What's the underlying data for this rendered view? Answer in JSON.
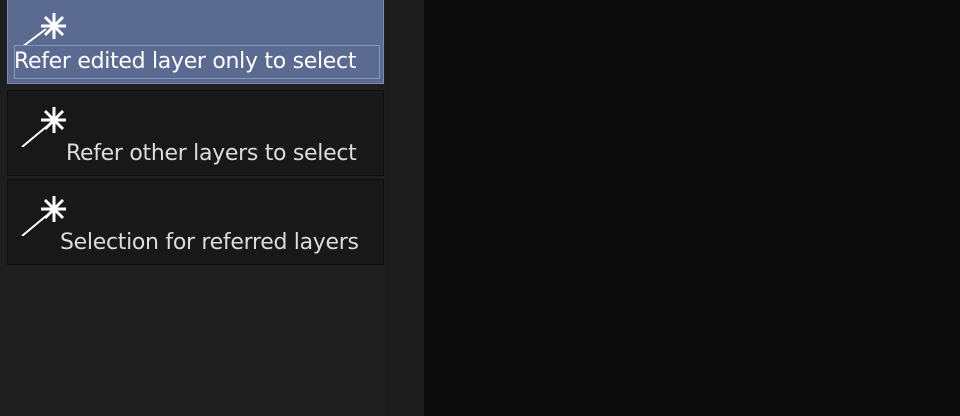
{
  "tools": [
    {
      "label": "Refer edited layer only to select",
      "icon": "magic-wand-icon",
      "selected": true
    },
    {
      "label": "Refer other layers to select",
      "icon": "magic-wand-icon",
      "selected": false
    },
    {
      "label": "Selection for referred layers",
      "icon": "magic-wand-icon",
      "selected": false
    }
  ],
  "colors": {
    "selected_bg": "#5b6a90",
    "item_bg": "#181818",
    "panel_bg": "#1e1e1e",
    "canvas_bg": "#0b0b0b",
    "text": "#dcdcdc"
  }
}
